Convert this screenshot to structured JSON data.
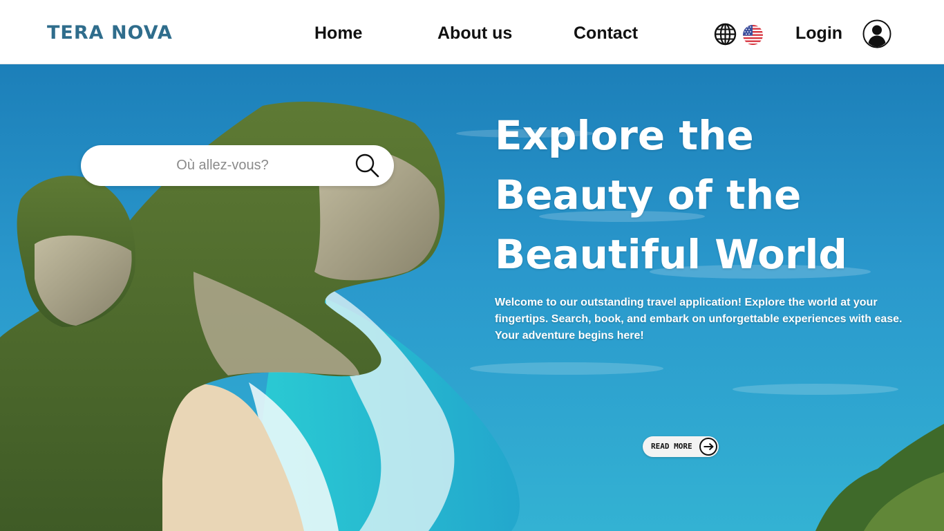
{
  "header": {
    "logo": "TERA NOVA",
    "nav": {
      "home": "Home",
      "about": "About us",
      "contact": "Contact"
    },
    "login": "Login"
  },
  "hero": {
    "search": {
      "placeholder": "Où allez-vous?"
    },
    "title": "Explore the Beauty of the Beautiful World",
    "description": "Welcome to our outstanding travel application! Explore the world at your fingertips. Search, book, and embark on unforgettable experiences with ease. Your adventure begins here!",
    "cta": "READ MORE"
  },
  "icons": {
    "globe": "globe-icon",
    "flag": "us-flag-icon",
    "avatar": "user-avatar-icon",
    "search": "search-icon",
    "arrow": "arrow-right-icon"
  },
  "colors": {
    "brand": "#2f6d8c",
    "ocean": "#1f86bf",
    "text_dark": "#111111"
  }
}
